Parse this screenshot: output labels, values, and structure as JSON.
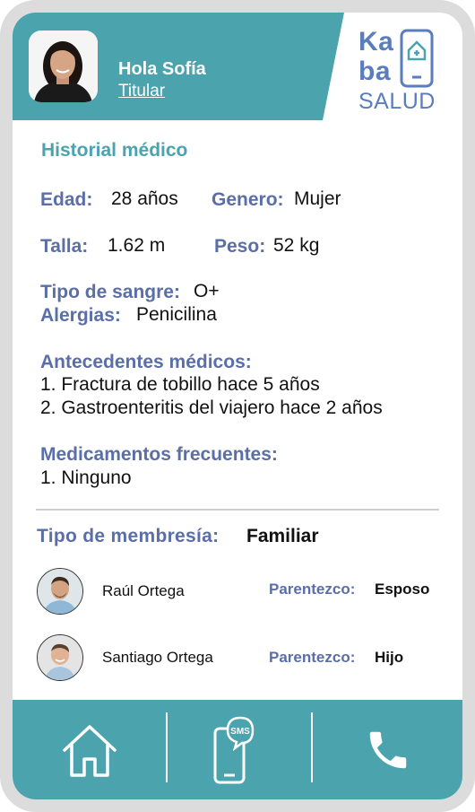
{
  "header": {
    "greeting": "Hola Sofía",
    "role": "Titular"
  },
  "logo": {
    "line1": "Ka",
    "line2": "ba",
    "line3": "SALUD"
  },
  "history": {
    "title": "Historial médico",
    "age_label": "Edad:",
    "age_value": "28 años",
    "gender_label": "Genero:",
    "gender_value": "Mujer",
    "height_label": "Talla:",
    "height_value": "1.62 m",
    "weight_label": "Peso:",
    "weight_value": "52 kg",
    "blood_label": "Tipo de sangre:",
    "blood_value": "O+",
    "allergy_label": "Alergias:",
    "allergy_value": "Penicilina",
    "background_label": "Antecedentes médicos:",
    "background_items": [
      "1. Fractura de tobillo hace 5 años",
      "2. Gastroenteritis del viajero hace 2 años"
    ],
    "meds_label": "Medicamentos frecuentes:",
    "meds_items": [
      "1. Ninguno"
    ]
  },
  "membership": {
    "label": "Tipo de membresía:",
    "value": "Familiar"
  },
  "family": [
    {
      "name": "Raúl Ortega",
      "relation_label": "Parentezco:",
      "relation": "Esposo"
    },
    {
      "name": "Santiago Ortega",
      "relation_label": "Parentezco:",
      "relation": "Hijo"
    }
  ],
  "bottom_nav": {
    "sms_text": "SMS",
    "icons": [
      "home-icon",
      "sms-icon",
      "phone-icon"
    ]
  },
  "colors": {
    "teal": "#4aa3ad",
    "label_blue": "#5a6ea8",
    "logo_blue": "#5a7dbd"
  }
}
